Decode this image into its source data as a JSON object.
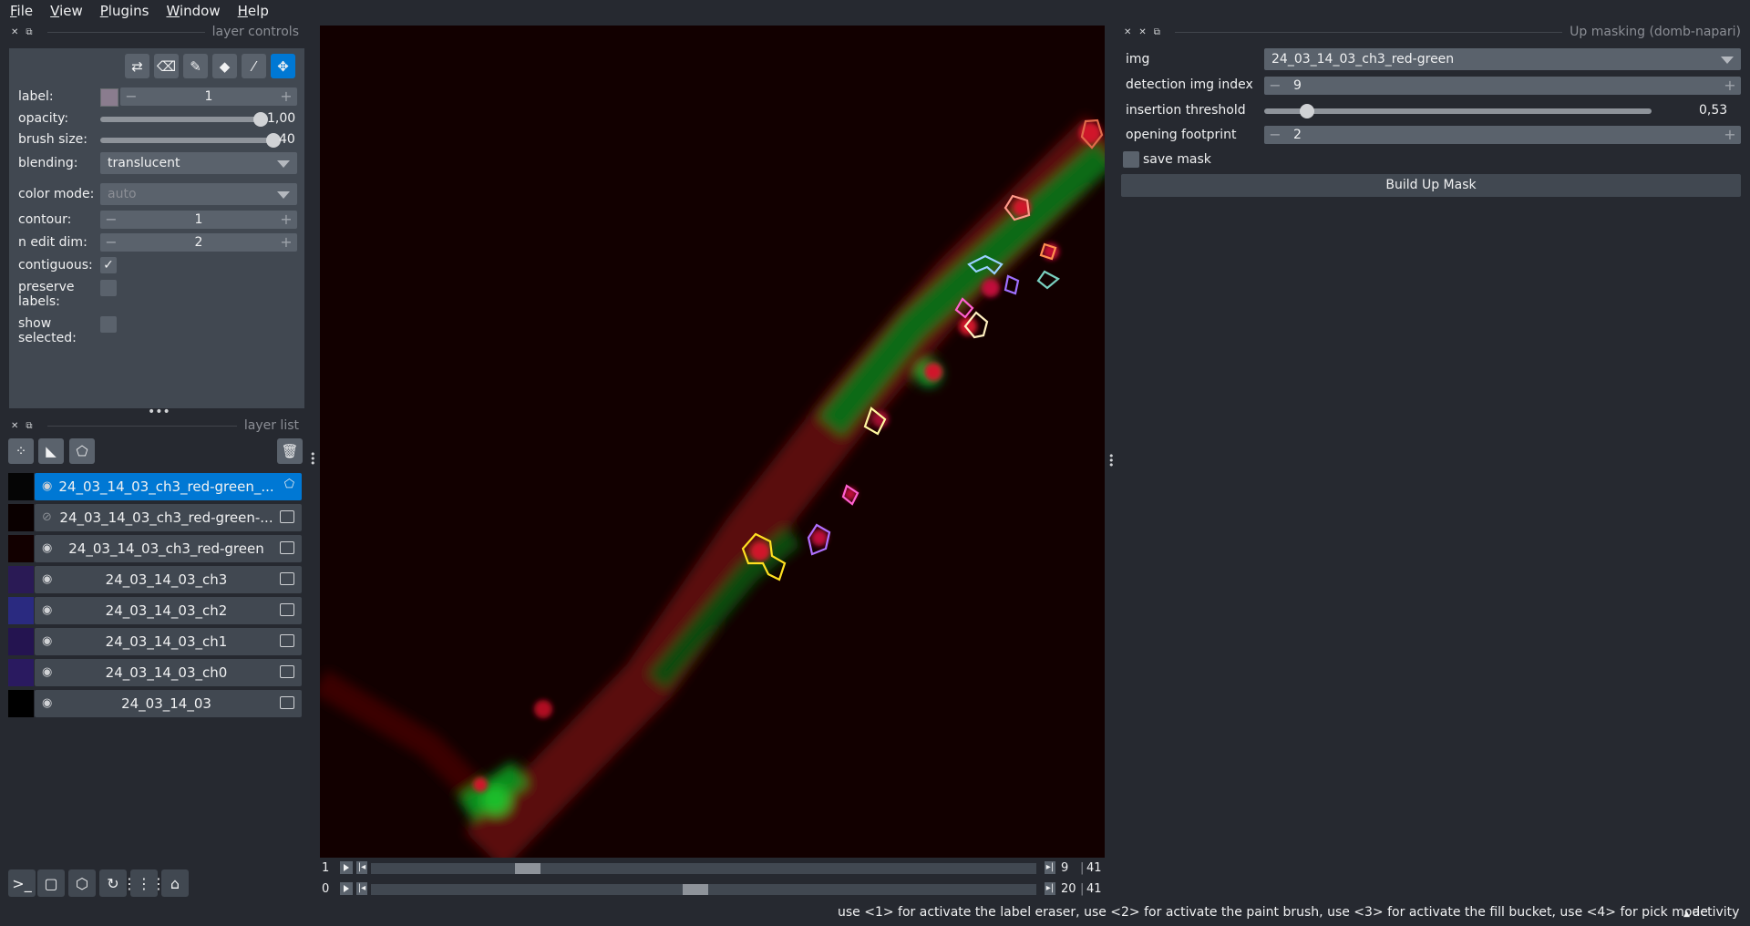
{
  "menu": [
    "File",
    "View",
    "Plugins",
    "Window",
    "Help"
  ],
  "layer_controls": {
    "title": "layer controls",
    "label_label": "label:",
    "label_value": "1",
    "opacity_label": "opacity:",
    "opacity_value": "1,00",
    "opacity_fraction": 1.0,
    "brush_label": "brush size:",
    "brush_value": "40",
    "brush_fraction": 1.0,
    "blending_label": "blending:",
    "blending_value": "translucent",
    "color_mode_label": "color mode:",
    "color_mode_value": "auto",
    "contour_label": "contour:",
    "contour_value": "1",
    "edit_dim_label": "n edit dim:",
    "edit_dim_value": "2",
    "contiguous_label": "contiguous:",
    "contiguous_checked": true,
    "preserve_label": "preserve\nlabels:",
    "show_selected_label": "show\nselected:"
  },
  "layer_list": {
    "title": "layer list",
    "layers": [
      {
        "name": "24_03_14_03_ch3_red-green_...",
        "selected": true,
        "visible": true,
        "type": "labels"
      },
      {
        "name": "24_03_14_03_ch3_red-green-...",
        "selected": false,
        "visible": false,
        "type": "image"
      },
      {
        "name": "24_03_14_03_ch3_red-green",
        "selected": false,
        "visible": true,
        "type": "image"
      },
      {
        "name": "24_03_14_03_ch3",
        "selected": false,
        "visible": true,
        "type": "image"
      },
      {
        "name": "24_03_14_03_ch2",
        "selected": false,
        "visible": true,
        "type": "image"
      },
      {
        "name": "24_03_14_03_ch1",
        "selected": false,
        "visible": true,
        "type": "image"
      },
      {
        "name": "24_03_14_03_ch0",
        "selected": false,
        "visible": true,
        "type": "image"
      },
      {
        "name": "24_03_14_03",
        "selected": false,
        "visible": true,
        "type": "image"
      }
    ]
  },
  "dims": [
    {
      "index": "1",
      "current": "9",
      "total": "41",
      "fraction": 0.235
    },
    {
      "index": "0",
      "current": "20",
      "total": "41",
      "fraction": 0.488
    }
  ],
  "plugin": {
    "title": "Up masking (domb-napari)",
    "img_label": "img",
    "img_value": "24_03_14_03_ch3_red-green",
    "detection_label": "detection img index",
    "detection_value": "9",
    "threshold_label": "insertion threshold",
    "threshold_value": "0,53",
    "threshold_fraction": 0.11,
    "footprint_label": "opening footprint",
    "footprint_value": "2",
    "save_mask_label": "save mask",
    "build_button": "Build Up Mask"
  },
  "status": {
    "message": "use <1> for activate the label eraser, use <2> for activate the paint brush, use <3> for activate the fill bucket, use <4> for pick mode",
    "activity": "activity"
  },
  "colors": {
    "accent": "#0078d4",
    "panel": "#414851",
    "background": "#262930"
  }
}
